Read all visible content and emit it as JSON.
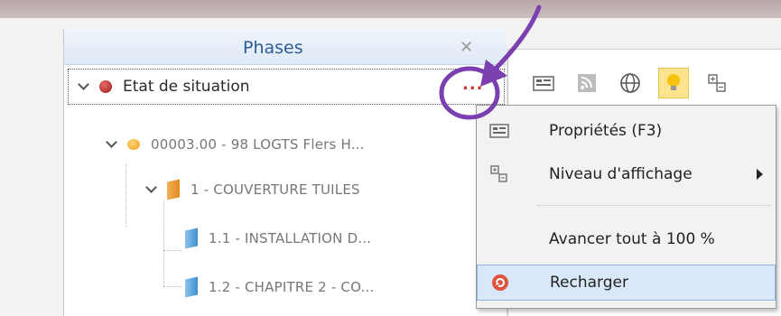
{
  "phases_panel": {
    "title": "Phases",
    "close_glyph": "✕",
    "tree": [
      {
        "label": "Etat de situation",
        "icon": "red-circle-icon",
        "more_label": "..."
      },
      {
        "label": "00003.00 - 98 LOGTS Flers H...",
        "icon": "yellow-circle-icon"
      },
      {
        "label": "1 - COUVERTURE TUILES",
        "icon": "orange-folder-icon"
      },
      {
        "label": "1.1 - INSTALLATION D...",
        "icon": "blue-folder-icon"
      },
      {
        "label": "1.2 - CHAPITRE 2 - CO...",
        "icon": "blue-folder-icon"
      }
    ]
  },
  "toolbar": {
    "buttons": [
      "properties-icon",
      "rss-icon",
      "globe-icon",
      "lightbulb-icon",
      "display-level-icon"
    ]
  },
  "context_menu": {
    "items": [
      {
        "label": "Propriétés (F3)",
        "icon": "properties-icon"
      },
      {
        "label": "Niveau d'affichage",
        "icon": "display-level-icon",
        "submenu": true
      },
      {
        "label": "Avancer tout à 100 %",
        "icon": ""
      },
      {
        "label": "Recharger",
        "icon": "reload-icon",
        "highlighted": true
      }
    ]
  },
  "annotation": {
    "color": "#7b3fb0",
    "shapes": [
      "circle-around-more-button",
      "arrow-to-more-button"
    ]
  },
  "colors": {
    "panel_title": "#2d5b95",
    "selected_highlight": "#fce48f",
    "menu_hover": "#d8e8f8",
    "more_dots": "#c0392b"
  }
}
